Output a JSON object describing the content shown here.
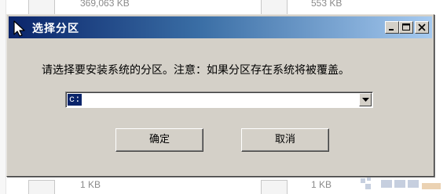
{
  "background": {
    "rows": [
      {
        "size": "369,063 KB"
      },
      {
        "size": "553 KB"
      },
      {
        "size": "1 KB"
      },
      {
        "size": "1 KB"
      }
    ]
  },
  "dialog": {
    "title": "选择分区",
    "prompt": "请选择要安装系统的分区。注意：如果分区存在系统将被覆盖。",
    "partition_select": {
      "value": "c:"
    },
    "ok_label": "确定",
    "cancel_label": "取消",
    "caption_buttons": [
      "minimize-icon",
      "maximize-icon",
      "close-icon"
    ]
  },
  "colors": {
    "titlebar_start": "#0a246a",
    "titlebar_end": "#a6caf0",
    "dialog_face": "#d4d0c8",
    "selection": "#0a246a"
  }
}
